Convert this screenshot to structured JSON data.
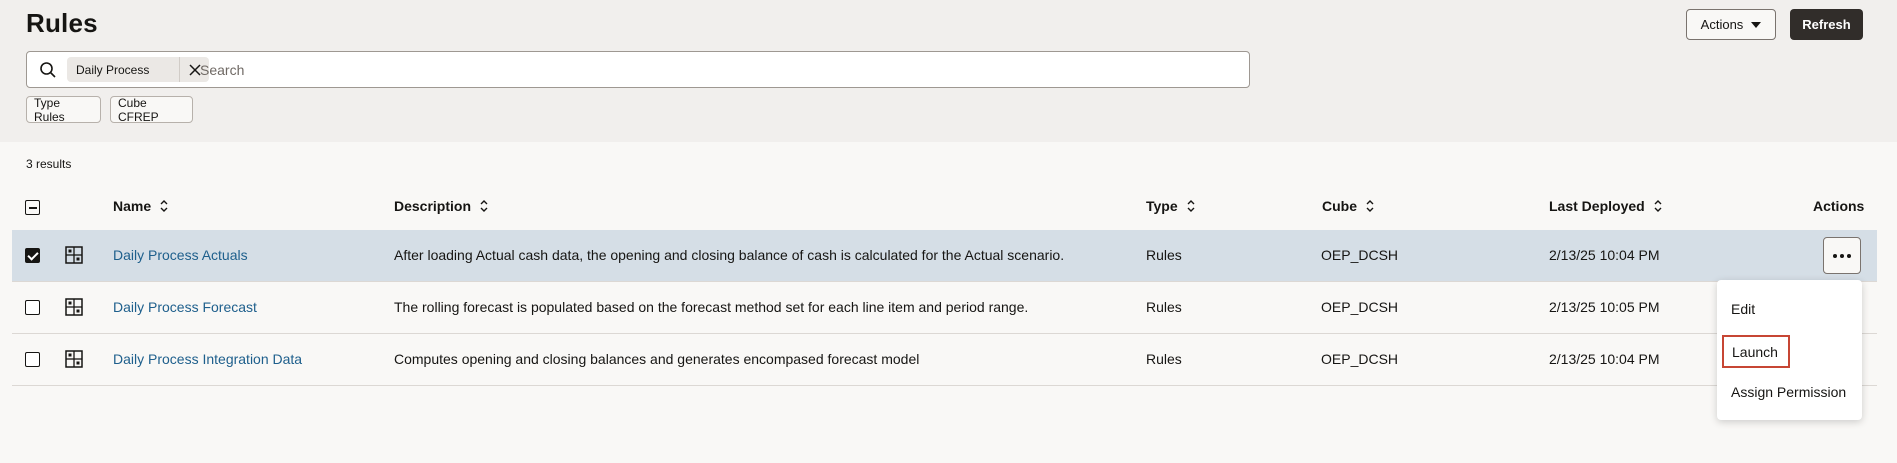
{
  "page": {
    "title": "Rules"
  },
  "toolbar": {
    "actions_label": "Actions",
    "refresh_label": "Refresh"
  },
  "search": {
    "chip_label": "Daily Process",
    "placeholder": "Search"
  },
  "facets": {
    "type_label": "Type Rules",
    "cube_label": "Cube CFREP"
  },
  "results": {
    "count_text": "3 results"
  },
  "table": {
    "columns": {
      "name": "Name",
      "description": "Description",
      "type": "Type",
      "cube": "Cube",
      "last_deployed": "Last Deployed",
      "actions": "Actions"
    },
    "rows": [
      {
        "name": "Daily Process Actuals",
        "description": "After loading Actual cash data, the opening and closing balance of cash is calculated for the Actual scenario.",
        "type": "Rules",
        "cube": "OEP_DCSH",
        "last_deployed": "2/13/25 10:04 PM",
        "selected": true
      },
      {
        "name": "Daily Process Forecast",
        "description": "The rolling forecast is populated based on the forecast method set for each line item and period range.",
        "type": "Rules",
        "cube": "OEP_DCSH",
        "last_deployed": "2/13/25 10:05 PM",
        "selected": false
      },
      {
        "name": "Daily Process Integration Data",
        "description": "Computes opening and closing balances and generates encompased forecast model",
        "type": "Rules",
        "cube": "OEP_DCSH",
        "last_deployed": "2/13/25 10:04 PM",
        "selected": false
      }
    ]
  },
  "menu": {
    "edit": "Edit",
    "launch": "Launch",
    "assign_permission": "Assign Permission"
  },
  "colors": {
    "link": "#1e5f8c",
    "primary_button": "#312d2a",
    "selected_row": "#d5dee6",
    "highlight": "#c74634"
  }
}
